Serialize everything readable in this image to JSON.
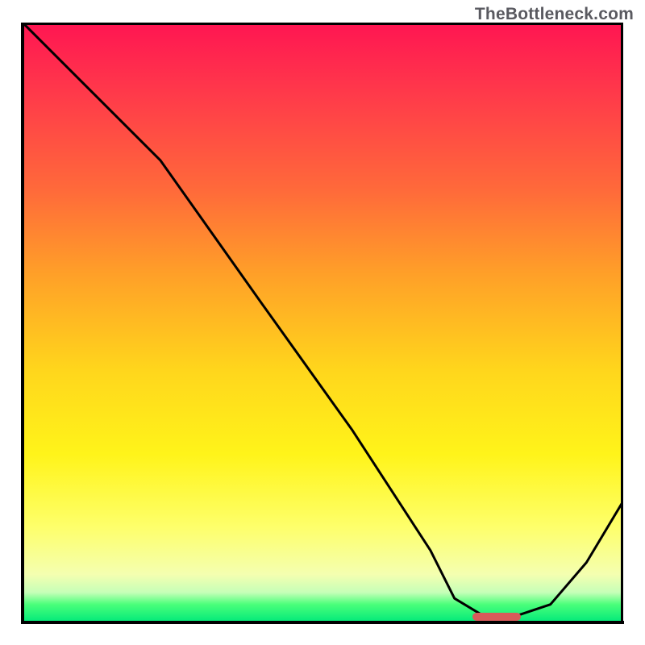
{
  "watermark": "TheBottleneck.com",
  "chart_data": {
    "type": "line",
    "title": "",
    "xlabel": "",
    "ylabel": "",
    "xlim": [
      0,
      100
    ],
    "ylim": [
      0,
      100
    ],
    "grid": false,
    "legend": false,
    "background": "vertical-gradient red→green",
    "series": [
      {
        "name": "bottleneck-curve",
        "x": [
          0,
          10,
          23,
          40,
          55,
          68,
          72,
          77,
          82,
          88,
          94,
          100
        ],
        "y": [
          100,
          90,
          77,
          53,
          32,
          12,
          4,
          1,
          1,
          3,
          10,
          20
        ],
        "color": "#000000",
        "stroke_width": 3
      }
    ],
    "marker": {
      "name": "optimal-range",
      "x_start": 75,
      "x_end": 83,
      "y": 1,
      "color": "#d85a5a"
    }
  }
}
